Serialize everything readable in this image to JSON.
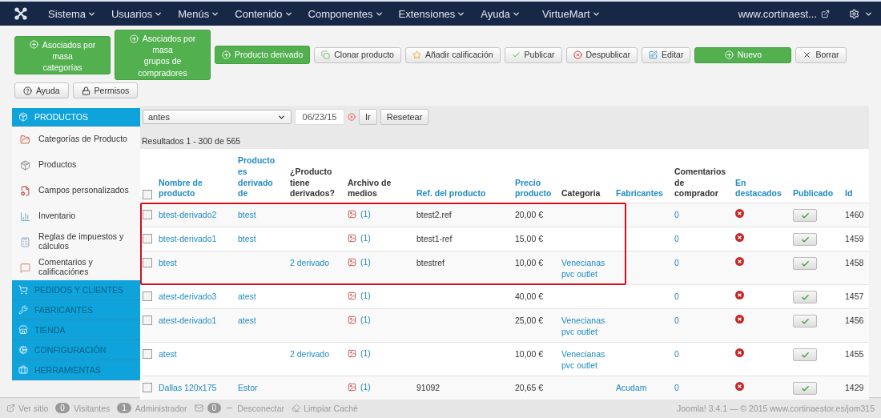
{
  "navbar": {
    "menus": [
      "Sistema",
      "Usuarios",
      "Menús",
      "Contenido",
      "Componentes",
      "Extensiones",
      "Ayuda",
      "VirtueMart"
    ],
    "site_link": "www.cortinaest..."
  },
  "toolbar": {
    "buttons": [
      {
        "label": "Asociados por\nmasa\ncategorías",
        "kind": "green"
      },
      {
        "label": "Asociados por\nmasa\ngrupos de\ncompradores",
        "kind": "green"
      },
      {
        "label": "Producto derivado",
        "kind": "green"
      },
      {
        "label": "Clonar producto",
        "kind": "default"
      },
      {
        "label": "Añadir calificación",
        "kind": "default"
      },
      {
        "label": "Publicar",
        "kind": "default"
      },
      {
        "label": "Despublicar",
        "kind": "default"
      },
      {
        "label": "Editar",
        "kind": "default"
      },
      {
        "label": "Nuevo",
        "kind": "wide-green"
      },
      {
        "label": "Borrar",
        "kind": "default"
      }
    ],
    "secondary": [
      "Ayuda",
      "Permisos"
    ]
  },
  "sidebar": {
    "sections": [
      {
        "title": "PRODUCTOS",
        "expanded": true,
        "items": [
          "Categorías de Producto",
          "Productos",
          "Campos personalizados",
          "Inventario",
          "Reglas de impuestos y cálculos",
          "Comentarios y calificaciónes"
        ]
      },
      {
        "title": "PEDIDOS Y CLIENTES",
        "expanded": false
      },
      {
        "title": "FABRICANTES",
        "expanded": false
      },
      {
        "title": "TIENDA",
        "expanded": false
      },
      {
        "title": "CONFIGURACIÓN",
        "expanded": false
      },
      {
        "title": "HERRAMIENTAS",
        "expanded": false
      }
    ]
  },
  "filter": {
    "select_value": "antes",
    "date": "06/23/15",
    "buttons": [
      "Ir",
      "Resetear"
    ]
  },
  "results": "Resultados 1 - 300 de 565",
  "table": {
    "select_all_checked": false,
    "columns": [
      {
        "label": "Nombre de\nproducto",
        "sortable": true
      },
      {
        "label": "Producto\nes\nderivado\nde",
        "sortable": true
      },
      {
        "label": "¿Producto\ntiene\nderivados?",
        "sortable": false
      },
      {
        "label": "Archivo de\nmedios",
        "sortable": false
      },
      {
        "label": "Ref. del producto",
        "sortable": true
      },
      {
        "label": "Precio\nproducto",
        "sortable": true
      },
      {
        "label": "Categoria",
        "sortable": false
      },
      {
        "label": "Fabricantes",
        "sortable": true
      },
      {
        "label": "Comentarios\nde\ncomprador",
        "sortable": false
      },
      {
        "label": "En\ndestacados",
        "sortable": true
      },
      {
        "label": "Publicado",
        "sortable": true
      },
      {
        "label": "Id",
        "sortable": true
      }
    ],
    "rows": [
      {
        "checked": false,
        "highlighted": true,
        "name": "btest-derivado2",
        "parent": "btest",
        "children": "",
        "media": "(1)",
        "ref": "btest2.ref",
        "price": "20,00 €",
        "category": "",
        "manufacturer": "",
        "comments": "0",
        "featured": false,
        "published": true,
        "id": "1460"
      },
      {
        "checked": false,
        "highlighted": true,
        "name": "btest-derivado1",
        "parent": "btest",
        "children": "",
        "media": "(1)",
        "ref": "btest1-ref",
        "price": "15,00 €",
        "category": "",
        "manufacturer": "",
        "comments": "0",
        "featured": false,
        "published": true,
        "id": "1459"
      },
      {
        "checked": false,
        "highlighted": true,
        "name": "btest",
        "parent": "",
        "children": "2 derivado",
        "media": "(1)",
        "ref": "btestref",
        "price": "10,00 €",
        "category": "Venecianas\npvc outlet",
        "manufacturer": "",
        "comments": "0",
        "featured": false,
        "published": true,
        "id": "1458"
      },
      {
        "checked": false,
        "highlighted": false,
        "name": "atest-derivado3",
        "parent": "atest",
        "children": "",
        "media": "(1)",
        "ref": "",
        "price": "40,00 €",
        "category": "",
        "manufacturer": "",
        "comments": "0",
        "featured": false,
        "published": true,
        "id": "1457"
      },
      {
        "checked": false,
        "highlighted": false,
        "name": "atest-derivado1",
        "parent": "atest",
        "children": "",
        "media": "(1)",
        "ref": "",
        "price": "25,00 €",
        "category": "Venecianas\npvc outlet",
        "manufacturer": "",
        "comments": "0",
        "featured": false,
        "published": true,
        "id": "1456"
      },
      {
        "checked": false,
        "highlighted": false,
        "name": "atest",
        "parent": "",
        "children": "2 derivado",
        "media": "(1)",
        "ref": "",
        "price": "10,00 €",
        "category": "Venecianas\npvc outlet",
        "manufacturer": "",
        "comments": "0",
        "featured": false,
        "published": true,
        "id": "1455"
      },
      {
        "checked": false,
        "highlighted": false,
        "name": "Dallas 120x175",
        "parent": "Estor",
        "children": "",
        "media": "(1)",
        "ref": "91092",
        "price": "20,65 €",
        "category": "",
        "manufacturer": "Acudam",
        "comments": "0",
        "featured": false,
        "published": true,
        "id": "1429"
      }
    ]
  },
  "status_bar": {
    "view_site": "Ver sitio",
    "visitors_count": "0",
    "visitors": "Visitantes",
    "admins_count": "1",
    "admins": "Administrador",
    "messages_count": "0",
    "logout": "Desconectar",
    "clear_cache": "Limpiar Caché",
    "copyright": "Joomla! 3.4.1 — © 2015 www.cortinaestor.es/jom315"
  }
}
